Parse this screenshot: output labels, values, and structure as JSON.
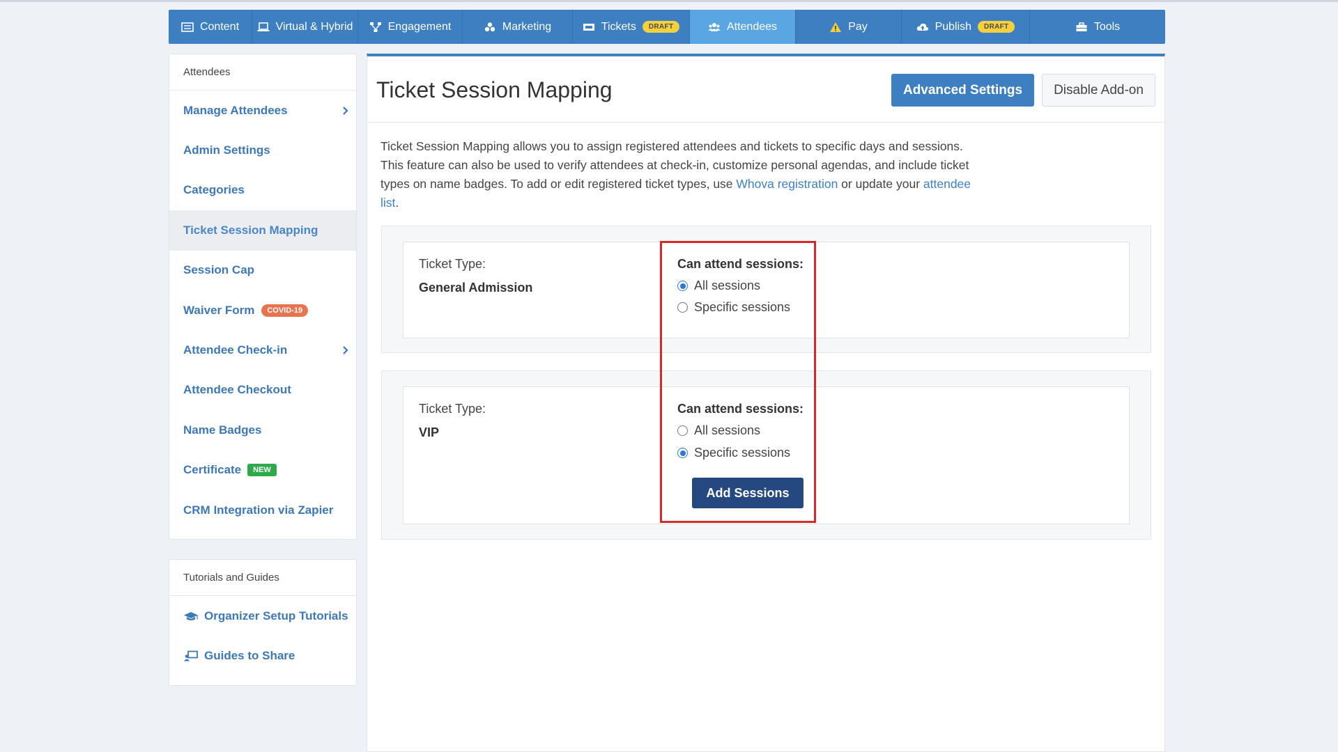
{
  "topnav": {
    "items": [
      {
        "label": "Content",
        "icon": "list-icon",
        "active": false
      },
      {
        "label": "Virtual & Hybrid",
        "icon": "laptop-icon",
        "active": false
      },
      {
        "label": "Engagement",
        "icon": "network-icon",
        "active": false
      },
      {
        "label": "Marketing",
        "icon": "bullhorn-icon",
        "active": false
      },
      {
        "label": "Tickets",
        "icon": "ticket-icon",
        "badge": "DRAFT",
        "active": false
      },
      {
        "label": "Attendees",
        "icon": "users-icon",
        "active": true
      },
      {
        "label": "Pay",
        "icon": "warning-icon",
        "active": false
      },
      {
        "label": "Publish",
        "icon": "cloud-upload-icon",
        "badge": "DRAFT",
        "active": false
      },
      {
        "label": "Tools",
        "icon": "briefcase-icon",
        "active": false
      }
    ]
  },
  "sidebar": {
    "header": "Attendees",
    "items": [
      {
        "label": "Manage Attendees",
        "chevron": true
      },
      {
        "label": "Admin Settings"
      },
      {
        "label": "Categories"
      },
      {
        "label": "Ticket Session Mapping",
        "active": true
      },
      {
        "label": "Session Cap"
      },
      {
        "label": "Waiver Form",
        "badge": "COVID-19"
      },
      {
        "label": "Attendee Check-in",
        "chevron": true
      },
      {
        "label": "Attendee Checkout"
      },
      {
        "label": "Name Badges"
      },
      {
        "label": "Certificate",
        "badge": "NEW"
      },
      {
        "label": "CRM Integration via Zapier"
      }
    ]
  },
  "guides": {
    "header": "Tutorials and Guides",
    "items": [
      {
        "label": "Organizer Setup Tutorials",
        "icon": "graduation-cap-icon"
      },
      {
        "label": "Guides to Share",
        "icon": "share-screen-icon"
      }
    ]
  },
  "main": {
    "title": "Ticket Session Mapping",
    "advanced_settings_label": "Advanced Settings",
    "disable_addon_label": "Disable Add-on",
    "description": {
      "line1": "Ticket Session Mapping allows you to assign registered attendees and tickets to specific days and sessions.",
      "line2": "This feature can also be used to verify attendees at check-in, customize personal agendas, and include ticket",
      "line3_prefix": "types on name badges. To add or edit registered ticket types, use ",
      "link_registration": "Whova registration",
      "middle": " or update your ",
      "link_attendee": "attendee",
      "link_list": "list",
      "end": "."
    },
    "tickets": [
      {
        "type_label": "Ticket Type:",
        "name": "General Admission",
        "sessions_label": "Can attend sessions:",
        "option_all": "All sessions",
        "option_specific": "Specific sessions",
        "selected": "all"
      },
      {
        "type_label": "Ticket Type:",
        "name": "VIP",
        "sessions_label": "Can attend sessions:",
        "option_all": "All sessions",
        "option_specific": "Specific sessions",
        "selected": "specific",
        "add_sessions_label": "Add Sessions"
      }
    ]
  },
  "colors": {
    "nav_bg": "#3d7fc0",
    "nav_active": "#5aa6e3",
    "link": "#3d78b8",
    "draft_badge": "#f4d03f",
    "covid_badge": "#e8744f",
    "new_badge": "#2eaa4a",
    "add_sessions_btn": "#24487f",
    "highlight": "#d42a2a"
  }
}
